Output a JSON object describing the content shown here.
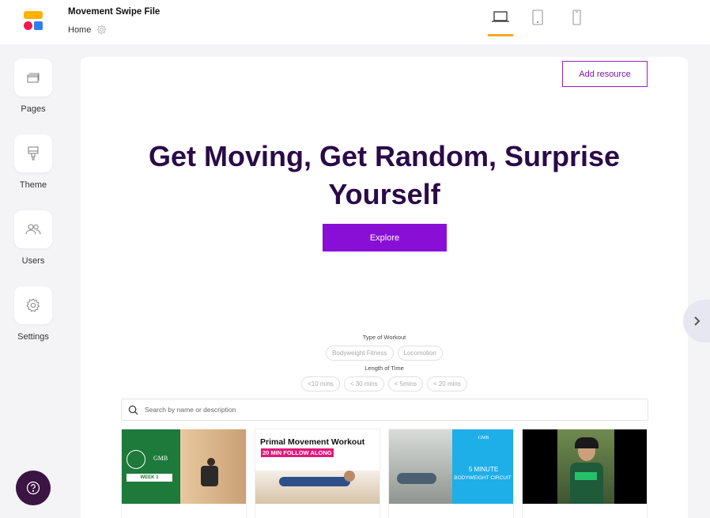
{
  "app": {
    "title": "Movement Swipe File",
    "breadcrumb": "Home"
  },
  "devices": [
    "desktop",
    "tablet",
    "mobile"
  ],
  "sidebar": {
    "items": [
      {
        "label": "Pages",
        "icon": "pages-icon"
      },
      {
        "label": "Theme",
        "icon": "paint-brush-icon"
      },
      {
        "label": "Users",
        "icon": "users-icon"
      },
      {
        "label": "Settings",
        "icon": "gear-icon"
      }
    ]
  },
  "main": {
    "add_resource_label": "Add resource",
    "hero_title": "Get Moving, Get Random, Surprise Yourself",
    "explore_label": "Explore",
    "filters": {
      "type_label": "Type of Workout",
      "type_options": [
        "Bodyweight Fitness",
        "Locomotion"
      ],
      "length_label": "Length of Time",
      "length_options": [
        "<10 mins",
        "< 30 mins",
        "< 5mins",
        "< 20 mins"
      ]
    },
    "search_placeholder": "Search by name or description",
    "cards": [
      {
        "thumb_text_1": "GMB",
        "thumb_text_2": "WEEK 1"
      },
      {
        "thumb_title": "Primal Movement Workout",
        "thumb_sub": "20 MIN FOLLOW ALONG"
      },
      {
        "thumb_text_1": "GMB",
        "thumb_text_2": "5 MINUTE",
        "thumb_text_3": "BODYWEIGHT CIRCUIT"
      },
      {
        "thumb_text_1": ""
      }
    ]
  },
  "colors": {
    "hero": "#2b0a48",
    "explore": "#8a0fd6",
    "accent_underline": "#f5a623",
    "help": "#3a1442"
  }
}
